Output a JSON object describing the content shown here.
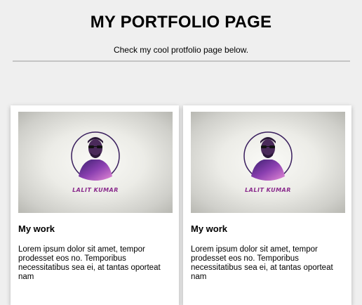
{
  "header": {
    "title": "MY PORTFOLIO PAGE",
    "subtitle": "Check my cool protfolio page below."
  },
  "cards": [
    {
      "logo_text": "LALIT KUMAR",
      "title": "My work",
      "text": "Lorem ipsum dolor sit amet, tempor prodesset eos no. Temporibus necessitatibus sea ei, at tantas oporteat nam"
    },
    {
      "logo_text": "LALIT KUMAR",
      "title": "My work",
      "text": "Lorem ipsum dolor sit amet, tempor prodesset eos no. Temporibus necessitatibus sea ei, at tantas oporteat nam"
    }
  ],
  "colors": {
    "background": "#efefef",
    "card": "#ffffff",
    "divider": "#c4c4c4",
    "logo_purple": "#8a2a8c"
  }
}
